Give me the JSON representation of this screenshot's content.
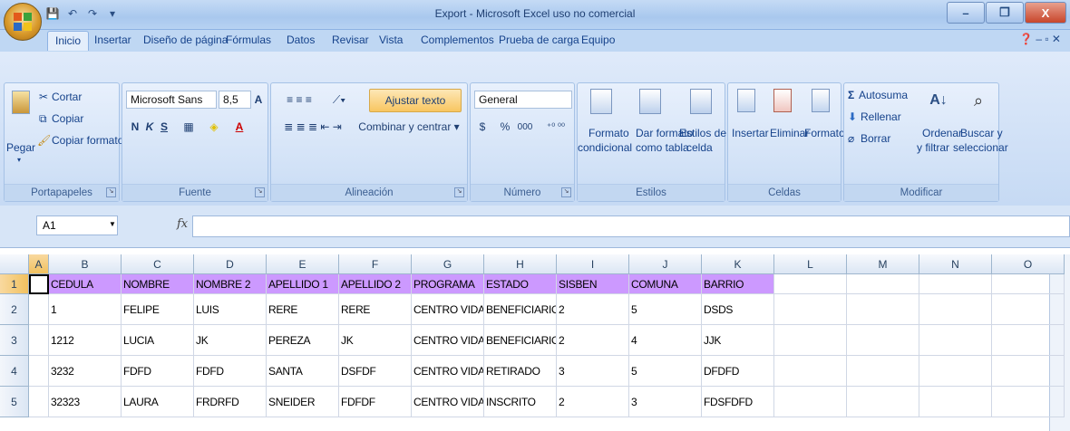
{
  "window": {
    "title": "Export - Microsoft Excel uso no comercial"
  },
  "tabs": [
    "Inicio",
    "Insertar",
    "Diseño de página",
    "Fórmulas",
    "Datos",
    "Revisar",
    "Vista",
    "Complementos",
    "Prueba de carga",
    "Equipo"
  ],
  "ribbon": {
    "clipboard": {
      "paste": "Pegar",
      "cut": "Cortar",
      "copy": "Copiar",
      "format_painter": "Copiar formato",
      "label": "Portapapeles"
    },
    "font": {
      "name": "Microsoft Sans",
      "size": "8,5",
      "bold": "N",
      "italic": "K",
      "underline": "S",
      "label": "Fuente"
    },
    "alignment": {
      "wrap": "Ajustar texto",
      "merge": "Combinar y centrar",
      "label": "Alineación"
    },
    "number": {
      "format": "General",
      "currency": "$",
      "percent": "%",
      "thousands": "000",
      "label": "Número"
    },
    "styles": {
      "cond1": "Formato",
      "cond2": "condicional",
      "table1": "Dar formato",
      "table2": "como tabla",
      "cell1": "Estilos de",
      "cell2": "celda",
      "label": "Estilos"
    },
    "cells": {
      "insert": "Insertar",
      "delete": "Eliminar",
      "format": "Formato",
      "label": "Celdas"
    },
    "editing": {
      "autosum": "Autosuma",
      "fill": "Rellenar",
      "clear": "Borrar",
      "sort1": "Ordenar",
      "sort2": "y filtrar",
      "find1": "Buscar y",
      "find2": "seleccionar",
      "label": "Modificar"
    }
  },
  "formula_bar": {
    "name_box": "A1",
    "fx": "fx",
    "value": ""
  },
  "columns": [
    "A",
    "B",
    "C",
    "D",
    "E",
    "F",
    "G",
    "H",
    "I",
    "J",
    "K",
    "L",
    "M",
    "N",
    "O"
  ],
  "rows": [
    {
      "n": "1",
      "cells": [
        "",
        "CEDULA",
        "NOMBRE",
        "NOMBRE 2",
        "APELLIDO 1",
        "APELLIDO 2",
        "PROGRAMA",
        "ESTADO",
        "SISBEN",
        "COMUNA",
        "BARRIO",
        "",
        "",
        "",
        ""
      ]
    },
    {
      "n": "2",
      "cells": [
        "",
        "1",
        "FELIPE",
        "LUIS",
        "RERE",
        "RERE",
        "CENTRO VIDA",
        "BENEFICIARIO",
        "2",
        "5",
        "DSDS",
        "",
        "",
        "",
        ""
      ]
    },
    {
      "n": "3",
      "cells": [
        "",
        "1212",
        "LUCIA",
        "JK",
        "PEREZA",
        "JK",
        "CENTRO VIDA",
        "BENEFICIARIO",
        "2",
        "4",
        "JJK",
        "",
        "",
        "",
        ""
      ]
    },
    {
      "n": "4",
      "cells": [
        "",
        "3232",
        "FDFD",
        "FDFD",
        "SANTA",
        "DSFDF",
        "CENTRO VIDA",
        "RETIRADO",
        "3",
        "5",
        "DFDFD",
        "",
        "",
        "",
        ""
      ]
    },
    {
      "n": "5",
      "cells": [
        "",
        "32323",
        "LAURA",
        "FRDRFD",
        "SNEIDER",
        "FDFDF",
        "CENTRO VIDA",
        "INSCRITO",
        "2",
        "3",
        "FDSFDFD",
        "",
        "",
        "",
        ""
      ]
    }
  ],
  "colors": {
    "header_fill": "#cc99ff",
    "selected_header": "#f1c15f",
    "ribbon": "#c6daf4"
  }
}
